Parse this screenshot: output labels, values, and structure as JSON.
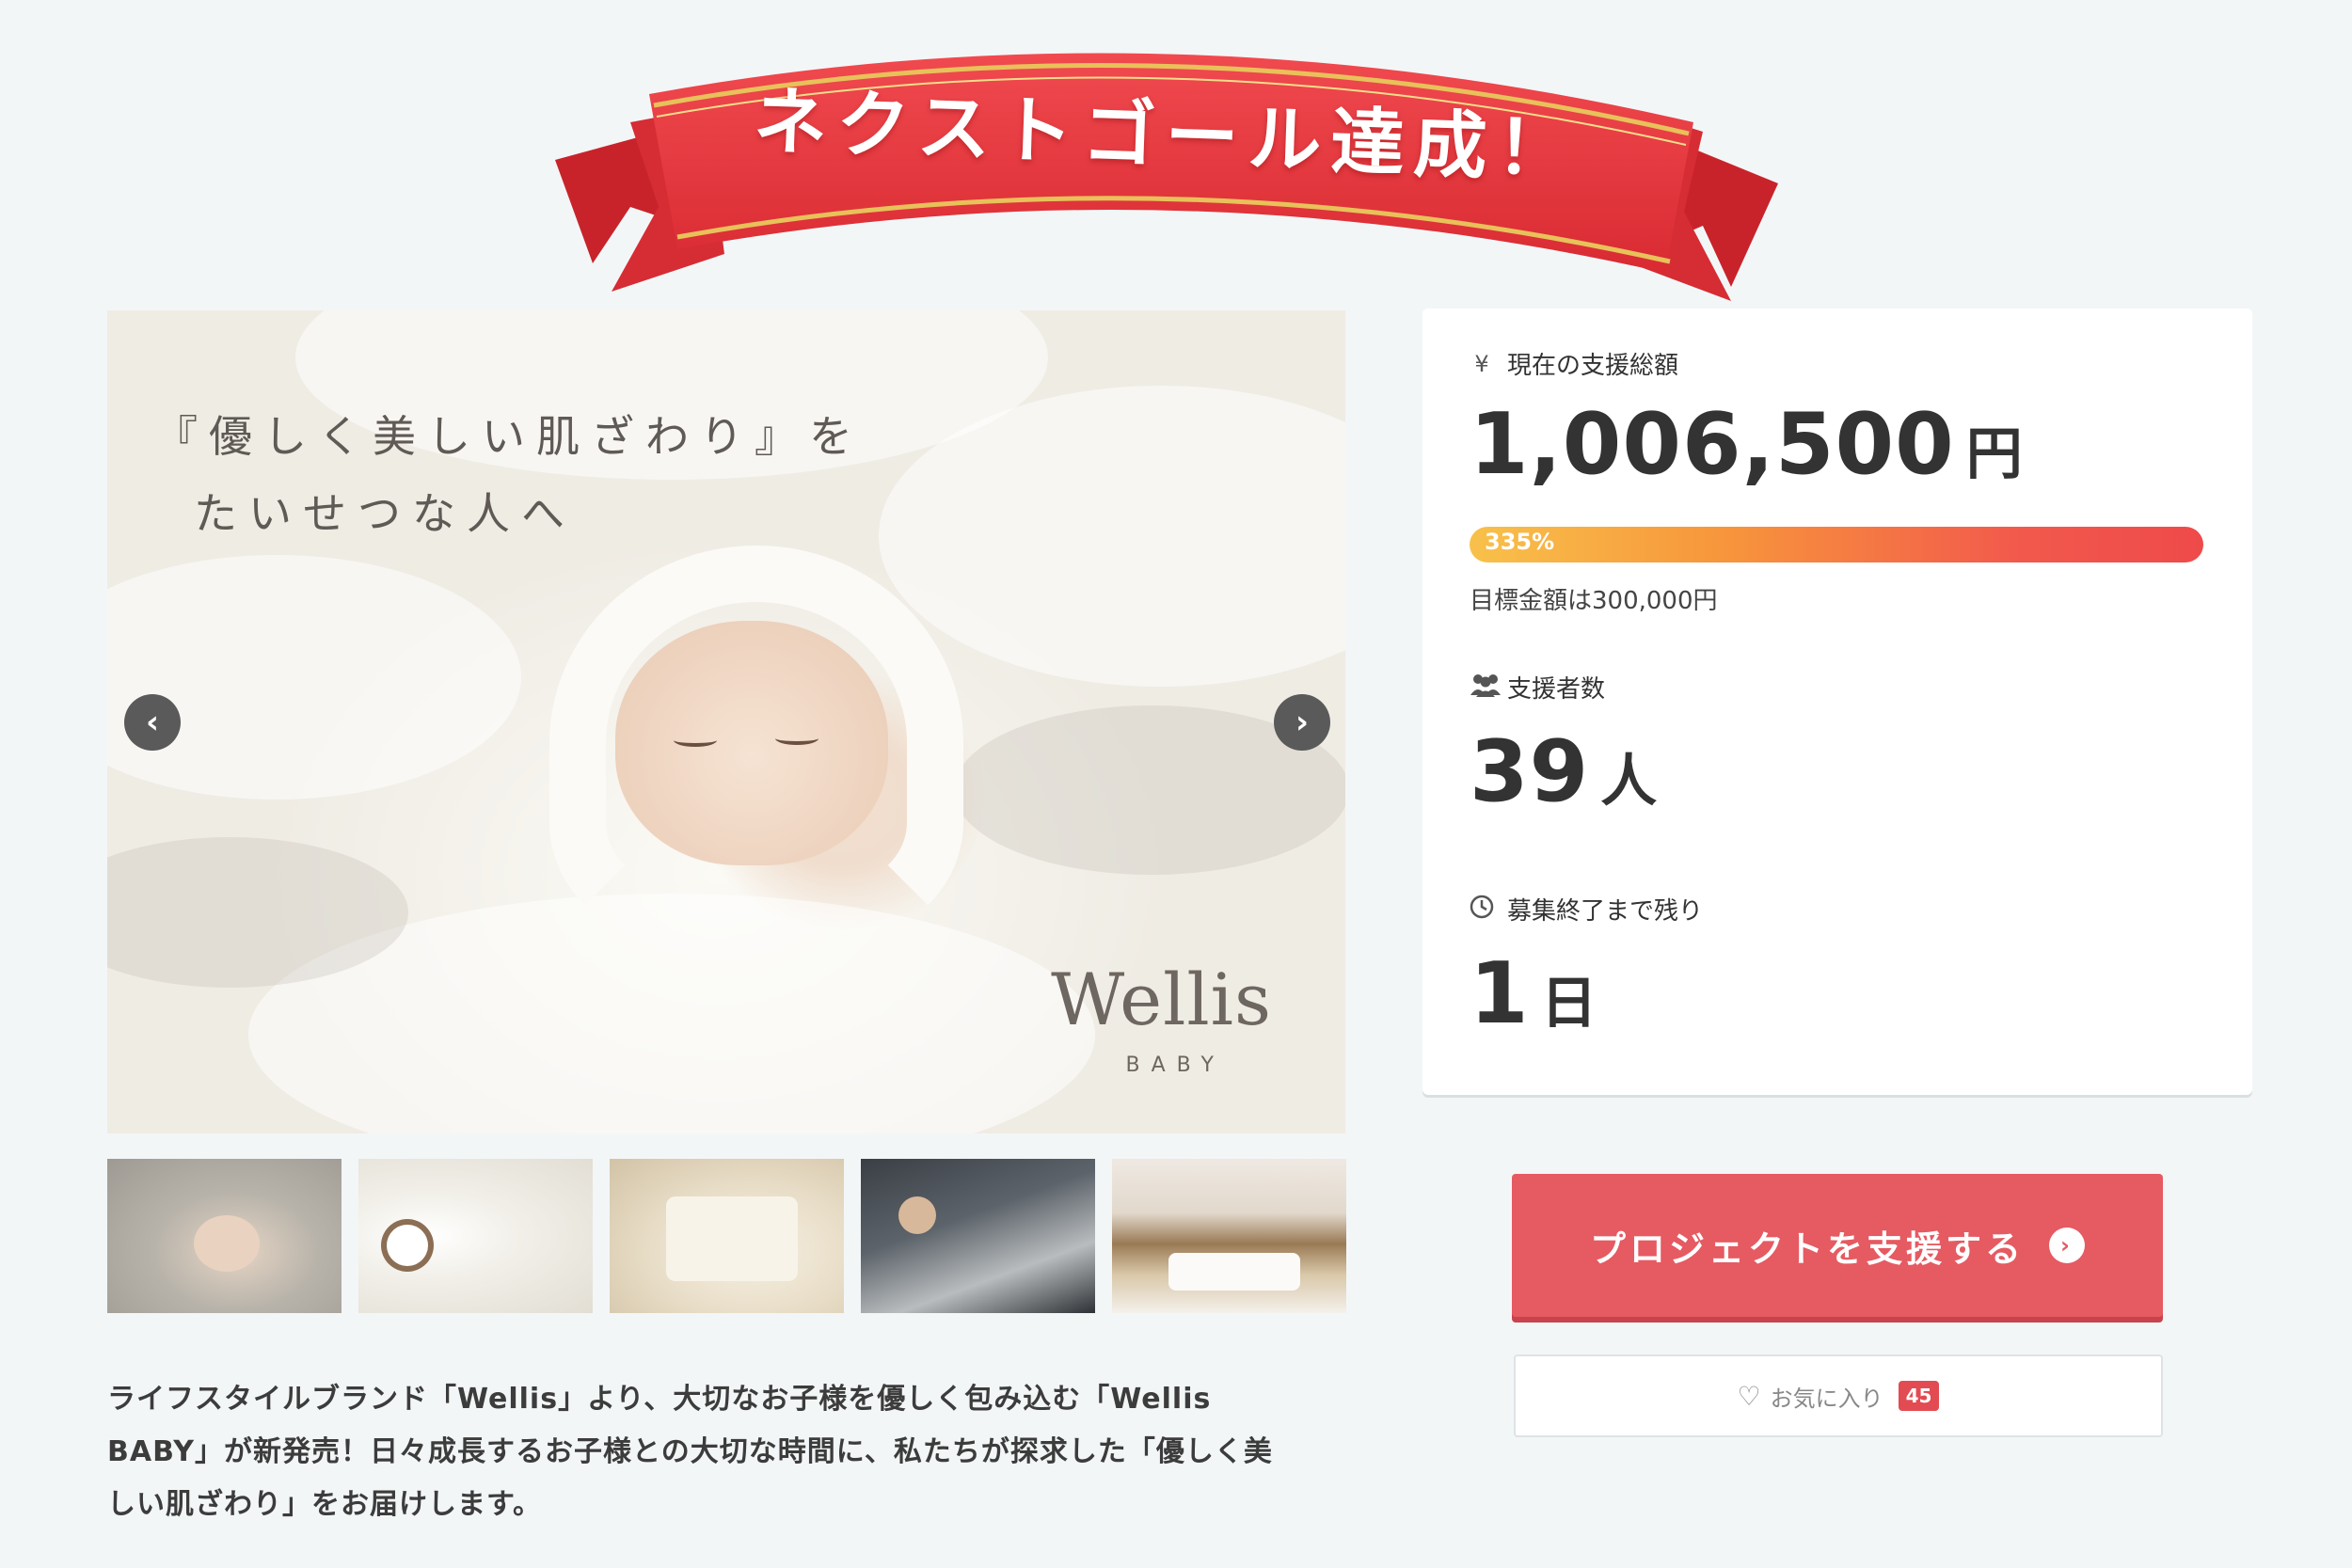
{
  "banner": {
    "text": "ネクストゴール達成！"
  },
  "main_image": {
    "caption_line1": "『優しく美しい肌ざわり』を",
    "caption_line2": "たいせつな人へ",
    "brand": "Wellis",
    "brand_sub": "BABY",
    "prev_icon": "chevron-left-icon",
    "next_icon": "chevron-right-icon"
  },
  "thumbnails": [
    {
      "name": "thumbnail-1"
    },
    {
      "name": "thumbnail-2"
    },
    {
      "name": "thumbnail-3"
    },
    {
      "name": "thumbnail-4"
    },
    {
      "name": "thumbnail-5"
    }
  ],
  "description": {
    "line1": "ライフスタイルブランド「Wellis」より、大切なお子様を優しく包み込む「Wellis",
    "line2": "BABY」が新発売！日々成長するお子様との大切な時間に、私たちが探求した「優しく美",
    "line3": "しい肌ざわり」をお届けします。"
  },
  "stats": {
    "total": {
      "icon": "yen-icon",
      "icon_glyph": "¥",
      "label": "現在の支援総額",
      "value": "1,006,500",
      "unit": "円"
    },
    "progress": {
      "percent_label": "335%",
      "percent": 335,
      "goal_text": "目標金額は300,000円"
    },
    "supporters": {
      "icon": "people-icon",
      "label": "支援者数",
      "value": "39",
      "unit": "人"
    },
    "remaining": {
      "icon": "clock-icon",
      "label": "募集終了まで残り",
      "value": "1",
      "unit": "日"
    }
  },
  "actions": {
    "support_label": "プロジェクトを支援する",
    "favorite_label": "お気に入り",
    "favorite_count": "45"
  },
  "colors": {
    "accent": "#e65a62",
    "ribbon": "#e8353c",
    "background": "#f3f6f7"
  }
}
